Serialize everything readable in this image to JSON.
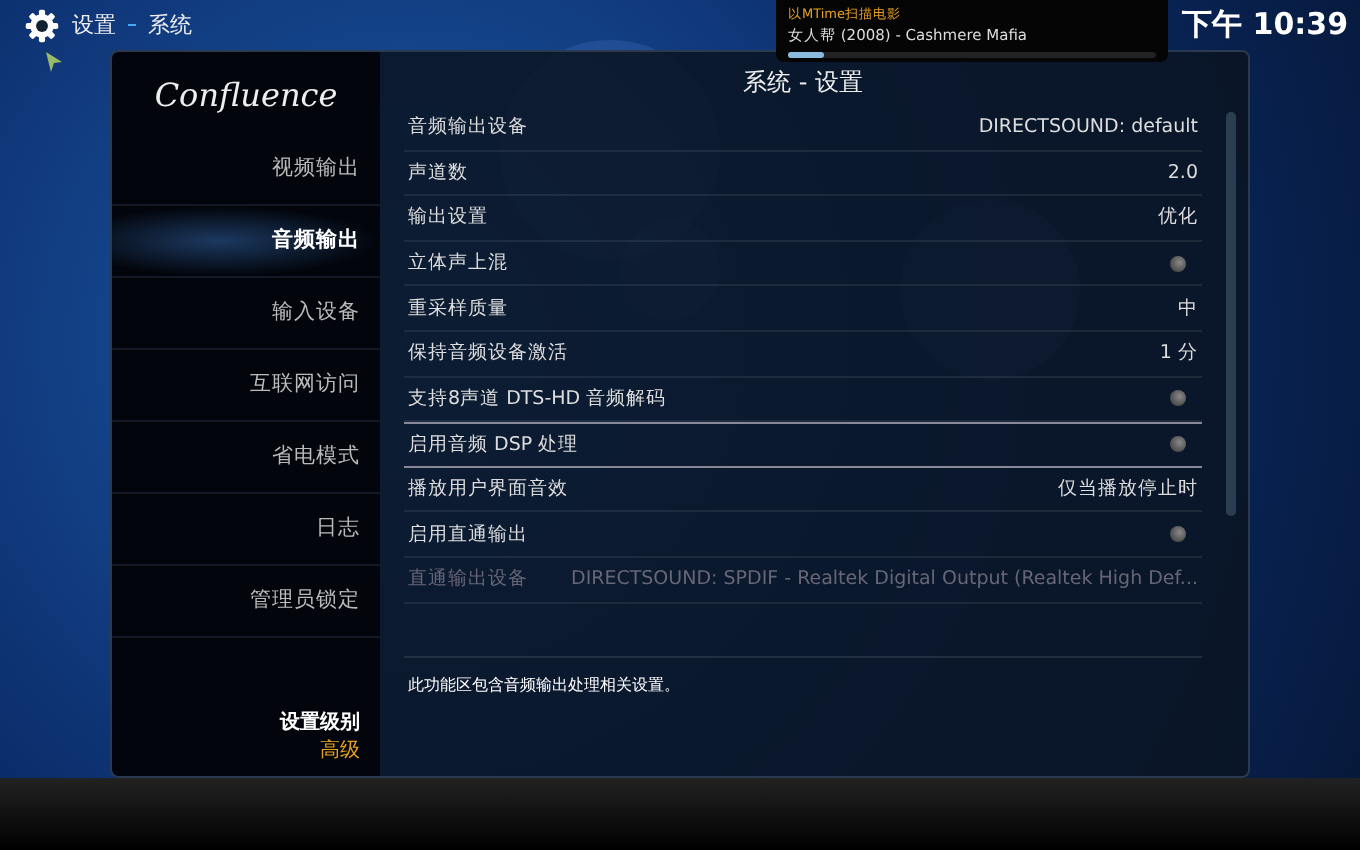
{
  "top_bar": {
    "breadcrumb": "设置",
    "section": "系统",
    "clock": "下午 10:39"
  },
  "notification": {
    "title": "以MTime扫描电影",
    "message": "女人帮 (2008) - Cashmere Mafia",
    "level": 0.1
  },
  "sidebar": {
    "logo": "Confluence",
    "items": [
      {
        "label": "视频输出",
        "selected": false
      },
      {
        "label": "音频输出",
        "selected": true
      },
      {
        "label": "输入设备",
        "selected": false
      },
      {
        "label": "互联网访问",
        "selected": false
      },
      {
        "label": "省电模式",
        "selected": false
      },
      {
        "label": "日志",
        "selected": false
      },
      {
        "label": "管理员锁定",
        "selected": false
      }
    ],
    "level_label": "设置级别",
    "level_value": "高级"
  },
  "panel": {
    "title": "系统 - 设置",
    "settings": [
      {
        "kind": "value",
        "label": "音频输出设备",
        "value": "DIRECTSOUND: default",
        "selected": false,
        "disabled": false
      },
      {
        "kind": "value",
        "label": "声道数",
        "value": "2.0",
        "selected": false,
        "disabled": false
      },
      {
        "kind": "value",
        "label": "输出设置",
        "value": "优化",
        "selected": false,
        "disabled": false
      },
      {
        "kind": "toggle",
        "label": "立体声上混",
        "on": false,
        "selected": false,
        "disabled": false
      },
      {
        "kind": "value",
        "label": "重采样质量",
        "value": "中",
        "selected": false,
        "disabled": false
      },
      {
        "kind": "value",
        "label": "保持音频设备激活",
        "value": "1 分",
        "selected": false,
        "disabled": false
      },
      {
        "kind": "toggle",
        "label": "支持8声道 DTS-HD 音频解码",
        "on": false,
        "selected": false,
        "disabled": false
      },
      {
        "kind": "toggle",
        "label": "启用音频 DSP 处理",
        "on": false,
        "selected": true,
        "disabled": false
      },
      {
        "kind": "value",
        "label": "播放用户界面音效",
        "value": "仅当播放停止时",
        "selected": false,
        "disabled": false
      },
      {
        "kind": "toggle",
        "label": "启用直通输出",
        "on": false,
        "selected": false,
        "disabled": false
      },
      {
        "kind": "value",
        "label": "直通输出设备",
        "value": "DIRECTSOUND: SPDIF - Realtek Digital Output (Realtek High Def...",
        "selected": false,
        "disabled": true
      }
    ],
    "description": "此功能区包含音频输出处理相关设置。"
  }
}
